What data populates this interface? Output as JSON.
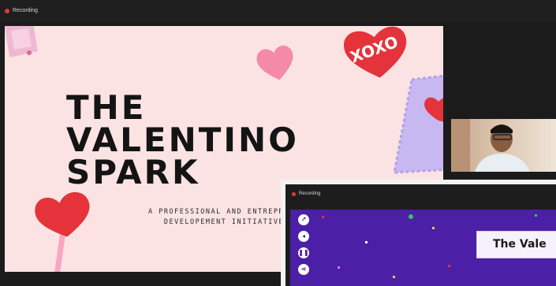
{
  "recording_label": "Recording",
  "slide": {
    "title_lines": [
      "THE",
      "VALENTINO",
      "SPARK"
    ],
    "subtitle_line1": "A PROFESSIONAL AND ENTREPRENE",
    "subtitle_line2": "DEVELOPEMENT INITIATIVE",
    "sticker_text": "XOXO",
    "colors": {
      "background": "#fbe3e3",
      "heart": "#e5333b",
      "pink_heart": "#f48aa8",
      "stamp": "#c8b8f2"
    }
  },
  "overlay": {
    "recording_label": "Recording",
    "title_card_text": "The Vale",
    "background_color": "#4b1fa6"
  }
}
